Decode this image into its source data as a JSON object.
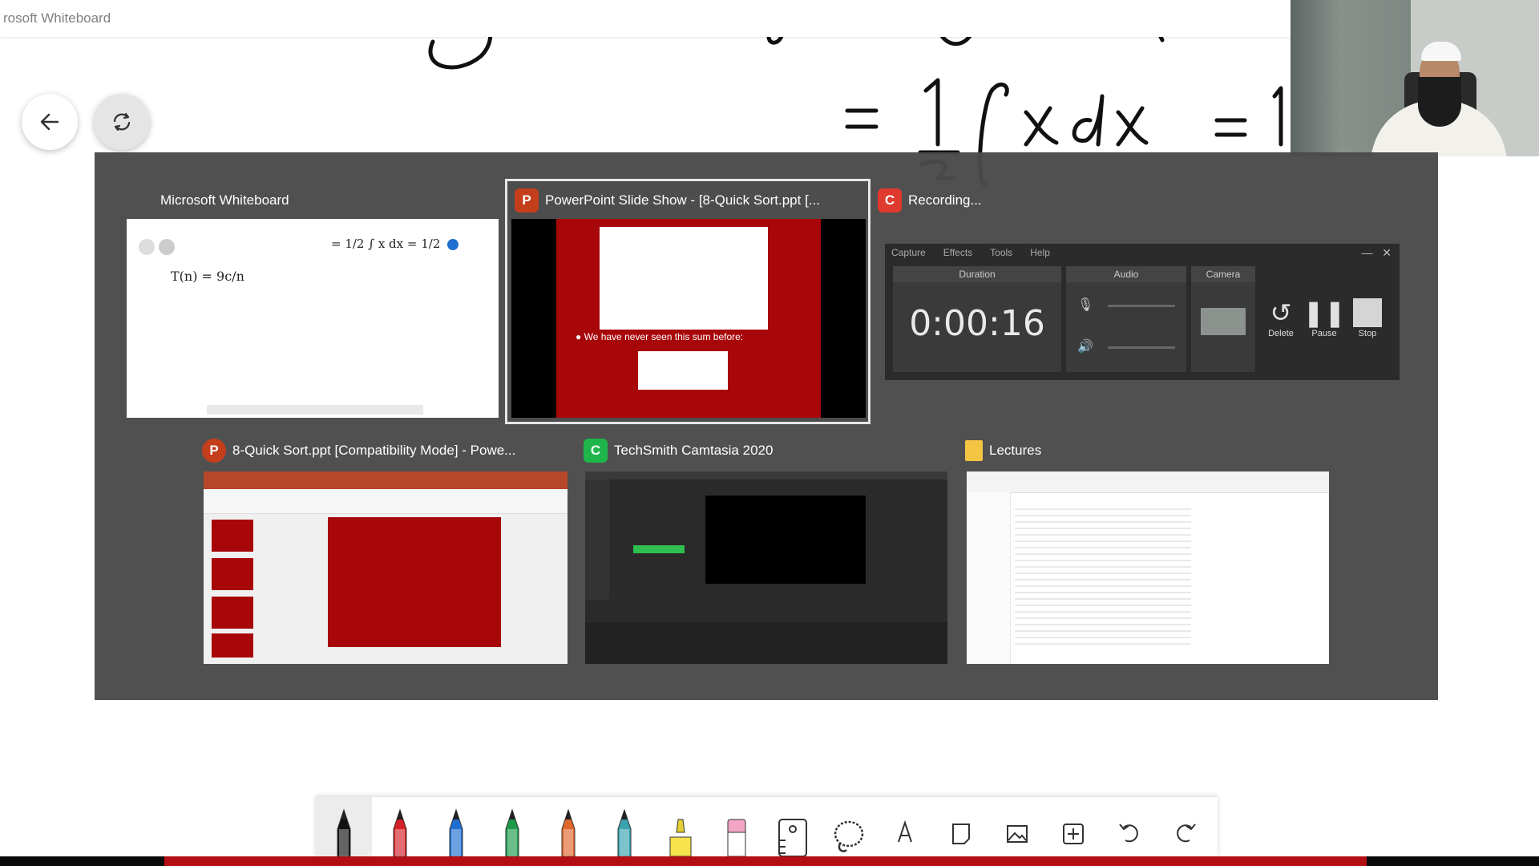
{
  "app": {
    "title": "rosoft Whiteboard"
  },
  "canvas_math": {
    "line1": "= 1/2 ∫ x dx = 1/2",
    "partial_top": "∫ x ... (  ... x ... ,"
  },
  "controls": {
    "back_icon": "arrow-left-icon",
    "sync_icon": "sync-icon"
  },
  "task_switcher": {
    "windows": [
      {
        "title": "Microsoft Whiteboard",
        "icon": "none",
        "selected": false
      },
      {
        "title": "PowerPoint Slide Show - [8-Quick Sort.ppt [...",
        "icon": "powerpoint-icon",
        "icon_color": "#c43e1c",
        "selected": true
      },
      {
        "title": "Recording...",
        "icon": "camtasia-recorder-icon",
        "icon_color": "#e03a2f",
        "selected": false
      },
      {
        "title": "8-Quick Sort.ppt [Compatibility Mode] - Powe...",
        "icon": "powerpoint-icon",
        "icon_color": "#c43e1c",
        "selected": false
      },
      {
        "title": "TechSmith Camtasia 2020",
        "icon": "camtasia-icon",
        "icon_color": "#1eb54a",
        "selected": false
      },
      {
        "title": "Lectures",
        "icon": "folder-icon",
        "icon_color": "#f4c542",
        "selected": false
      }
    ],
    "whiteboard_thumb": {
      "formula": "T(n) = 9c/n",
      "line": "= 1/2 ∫ x dx = 1/2"
    },
    "slideshow_thumb": {
      "bullet": "We have never seen this sum before:"
    },
    "recording": {
      "menu": [
        "Capture",
        "Effects",
        "Tools",
        "Help"
      ],
      "duration_label": "Duration",
      "audio_label": "Audio",
      "camera_label": "Camera",
      "time": "0:00:16",
      "delete_label": "Delete",
      "pause_label": "Pause",
      "stop_label": "Stop"
    }
  },
  "toolbar": {
    "tools": [
      {
        "name": "pen-black",
        "color": "#111111"
      },
      {
        "name": "pen-red",
        "color": "#d42027"
      },
      {
        "name": "pen-blue",
        "color": "#1f6fd1"
      },
      {
        "name": "pen-green",
        "color": "#1d9a4a"
      },
      {
        "name": "pen-rainbow",
        "color": "#e0662c"
      },
      {
        "name": "pen-galaxy",
        "color": "#3aa3b0"
      },
      {
        "name": "highlighter",
        "color": "#f6e24a"
      },
      {
        "name": "eraser",
        "color": "#f2a5c4"
      },
      {
        "name": "ruler",
        "color": "#333333"
      },
      {
        "name": "lasso",
        "color": "#333333"
      },
      {
        "name": "text",
        "color": "#333333"
      },
      {
        "name": "note",
        "color": "#333333"
      },
      {
        "name": "image",
        "color": "#333333"
      },
      {
        "name": "insert",
        "color": "#333333"
      },
      {
        "name": "undo",
        "color": "#333333"
      },
      {
        "name": "redo",
        "color": "#333333"
      }
    ]
  }
}
